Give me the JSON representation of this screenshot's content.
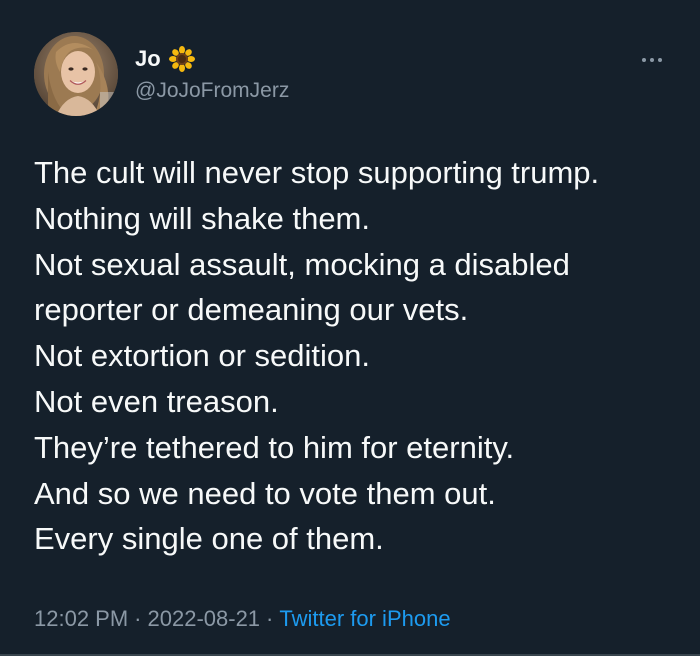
{
  "author": {
    "display_name": "Jo",
    "name_emoji": "🌻",
    "handle": "@JoJoFromJerz"
  },
  "tweet": {
    "lines": [
      "The cult will never stop supporting trump.",
      "Nothing will shake them.",
      "Not sexual assault, mocking a disabled",
      "reporter or demeaning our vets.",
      "Not extortion or sedition.",
      "Not even treason.",
      "They’re tethered to him for eternity.",
      "And so we need to vote them out.",
      "Every single one of them."
    ],
    "time": "12:02 PM",
    "date": "2022-08-21",
    "separator": "·",
    "source": "Twitter for iPhone"
  },
  "icons": {
    "more": "more-horizontal-icon",
    "avatar": "profile-photo"
  },
  "colors": {
    "background": "#15202b",
    "text_primary": "#f7f9f9",
    "text_secondary": "#8b98a5",
    "link": "#1d9bf0"
  }
}
